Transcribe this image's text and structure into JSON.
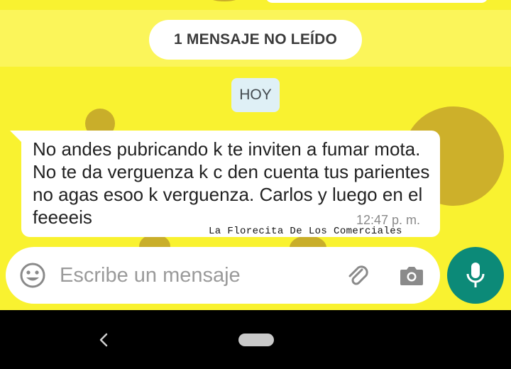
{
  "chat": {
    "unread_banner": "1 MENSAJE NO LEÍDO",
    "date_label": "HOY",
    "message": {
      "text": "No andes pubricando k te inviten a fumar mota. No te da verguenza k c den cuenta tus parientes no agas esoo k verguenza. Carlos y luego en el feeeeis",
      "time": "12:47 p. m."
    },
    "watermark": "La Florecita De Los Comerciales"
  },
  "composer": {
    "placeholder": "Escribe un mensaje",
    "icons": {
      "emoji": "emoji-icon",
      "attach": "paperclip-icon",
      "camera": "camera-icon",
      "mic": "microphone-icon"
    }
  },
  "navigation": {
    "icons": {
      "back": "back-chevron-icon",
      "home": "home-pill-icon"
    }
  },
  "colors": {
    "wallpaper": "#f9f230",
    "accent": "#0c8a78",
    "bubble": "#ffffff",
    "date_pill": "#dff0f6"
  }
}
